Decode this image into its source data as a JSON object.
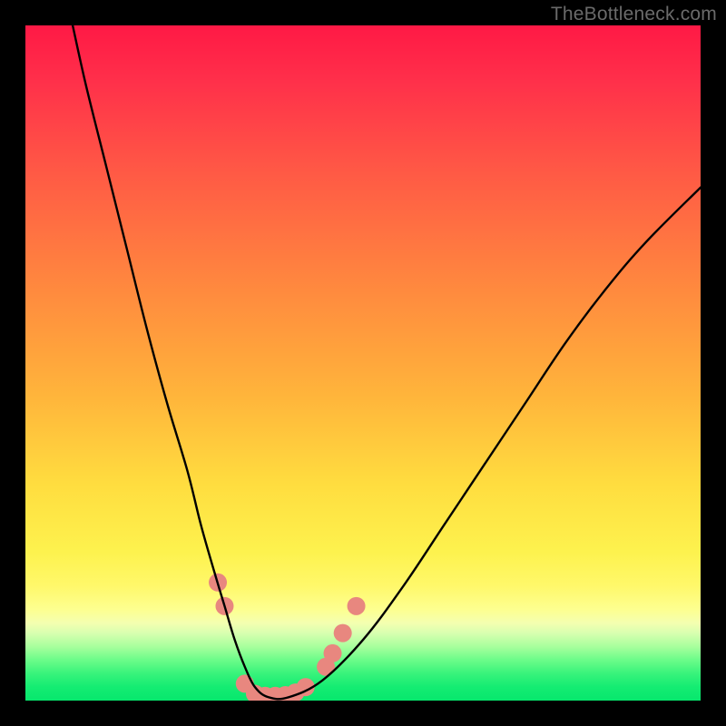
{
  "watermark": "TheBottleneck.com",
  "chart_data": {
    "type": "line",
    "title": "",
    "xlabel": "",
    "ylabel": "",
    "xlim": [
      0,
      100
    ],
    "ylim": [
      0,
      100
    ],
    "grid": false,
    "background_gradient": {
      "top": "#ff1945",
      "middle": "#ffdd3f",
      "bottom": "#07e76d"
    },
    "series": [
      {
        "name": "bottleneck-curve",
        "color": "#000000",
        "x": [
          7,
          9,
          12,
          15,
          18,
          21,
          24,
          26,
          28,
          29.5,
          31,
          32.5,
          34,
          36,
          39,
          44,
          50,
          56,
          62,
          68,
          74,
          80,
          86,
          92,
          100
        ],
        "y": [
          100,
          91,
          79,
          67,
          55,
          44,
          34,
          26,
          19,
          14,
          9,
          5,
          2,
          0.5,
          0.5,
          3,
          9,
          17,
          26,
          35,
          44,
          53,
          61,
          68,
          76
        ]
      }
    ],
    "markers": {
      "name": "highlight-points",
      "color": "#e8877f",
      "radius_px": 10,
      "points": [
        {
          "x": 28.5,
          "y": 17.5
        },
        {
          "x": 29.5,
          "y": 14
        },
        {
          "x": 32.5,
          "y": 2.5
        },
        {
          "x": 34,
          "y": 1
        },
        {
          "x": 35.5,
          "y": 0.7
        },
        {
          "x": 37,
          "y": 0.7
        },
        {
          "x": 38.5,
          "y": 0.8
        },
        {
          "x": 40,
          "y": 1.2
        },
        {
          "x": 41.5,
          "y": 2
        },
        {
          "x": 44.5,
          "y": 5
        },
        {
          "x": 45.5,
          "y": 7
        },
        {
          "x": 47,
          "y": 10
        },
        {
          "x": 49,
          "y": 14
        }
      ]
    }
  }
}
